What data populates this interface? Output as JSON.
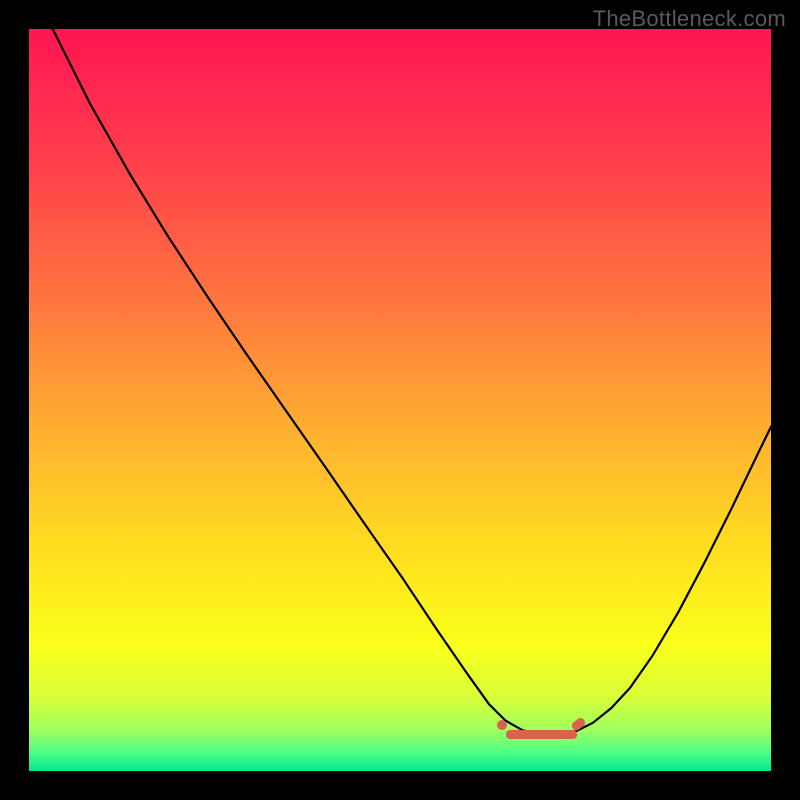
{
  "watermark": "TheBottleneck.com",
  "chart_data": {
    "type": "line",
    "title": "",
    "xlabel": "",
    "ylabel": "",
    "x_range": [
      0,
      100
    ],
    "y_range": [
      0,
      100
    ],
    "curve_points_norm": [
      [
        0.032,
        0.0
      ],
      [
        0.083,
        0.102
      ],
      [
        0.135,
        0.194
      ],
      [
        0.187,
        0.279
      ],
      [
        0.24,
        0.36
      ],
      [
        0.293,
        0.438
      ],
      [
        0.346,
        0.514
      ],
      [
        0.399,
        0.59
      ],
      [
        0.451,
        0.665
      ],
      [
        0.504,
        0.741
      ],
      [
        0.55,
        0.81
      ],
      [
        0.59,
        0.868
      ],
      [
        0.62,
        0.91
      ],
      [
        0.642,
        0.932
      ],
      [
        0.665,
        0.945
      ],
      [
        0.69,
        0.951
      ],
      [
        0.715,
        0.951
      ],
      [
        0.738,
        0.946
      ],
      [
        0.76,
        0.935
      ],
      [
        0.785,
        0.915
      ],
      [
        0.81,
        0.888
      ],
      [
        0.84,
        0.845
      ],
      [
        0.875,
        0.786
      ],
      [
        0.91,
        0.72
      ],
      [
        0.945,
        0.65
      ],
      [
        0.98,
        0.577
      ],
      [
        1.0,
        0.536
      ]
    ],
    "marker_region_norm": {
      "x_start": 0.637,
      "x_end": 0.752,
      "y": 0.95
    },
    "gradient_stops": [
      {
        "offset": 0.0,
        "color": "#ff1552"
      },
      {
        "offset": 0.18,
        "color": "#ff3f4b"
      },
      {
        "offset": 0.38,
        "color": "#ff7a3e"
      },
      {
        "offset": 0.55,
        "color": "#ffb22f"
      },
      {
        "offset": 0.72,
        "color": "#ffe31e"
      },
      {
        "offset": 0.83,
        "color": "#faff1a"
      },
      {
        "offset": 0.9,
        "color": "#d9ff38"
      },
      {
        "offset": 0.945,
        "color": "#9fff5e"
      },
      {
        "offset": 0.975,
        "color": "#4dff86"
      },
      {
        "offset": 1.0,
        "color": "#00e88e"
      }
    ]
  }
}
